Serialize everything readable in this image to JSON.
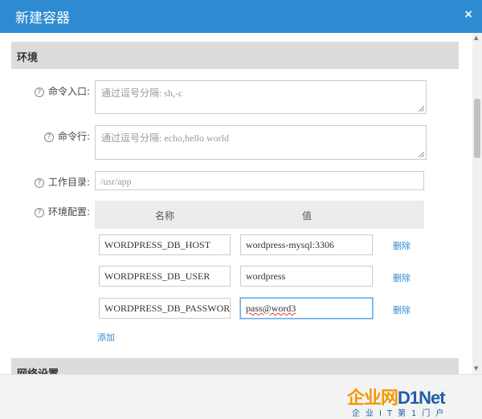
{
  "dialog": {
    "title": "新建容器",
    "close_glyph": "×"
  },
  "sections": {
    "env": "环境",
    "network": "网络设置"
  },
  "fields": {
    "entrypoint": {
      "label": "命令入口:",
      "placeholder": "通过逗号分隔: sh,-c"
    },
    "command": {
      "label": "命令行:",
      "placeholder": "通过逗号分隔: echo,hello world"
    },
    "workdir": {
      "label": "工作目录:",
      "value": "/usr/app"
    },
    "envconfig": {
      "label": "环境配置:"
    }
  },
  "env_table": {
    "headers": {
      "name": "名称",
      "value": "值"
    },
    "rows": [
      {
        "name": "WORDPRESS_DB_HOST",
        "value": "wordpress-mysql:3306",
        "action": "删除"
      },
      {
        "name": "WORDPRESS_DB_USER",
        "value": "wordpress",
        "action": "删除"
      },
      {
        "name": "WORDPRESS_DB_PASSWORD",
        "value": "pass@word3",
        "action": "删除"
      }
    ],
    "add_label": "添加"
  },
  "help_glyph": "?",
  "watermark": {
    "logo": "企业网D1Net",
    "tagline": "企业IT第1门户"
  },
  "colors": {
    "titlebar": "#2f8bd1",
    "link": "#2f8bd1",
    "section_bg": "#dcdcdc",
    "logo_orange": "#f39800",
    "logo_blue": "#1e5ea8"
  }
}
